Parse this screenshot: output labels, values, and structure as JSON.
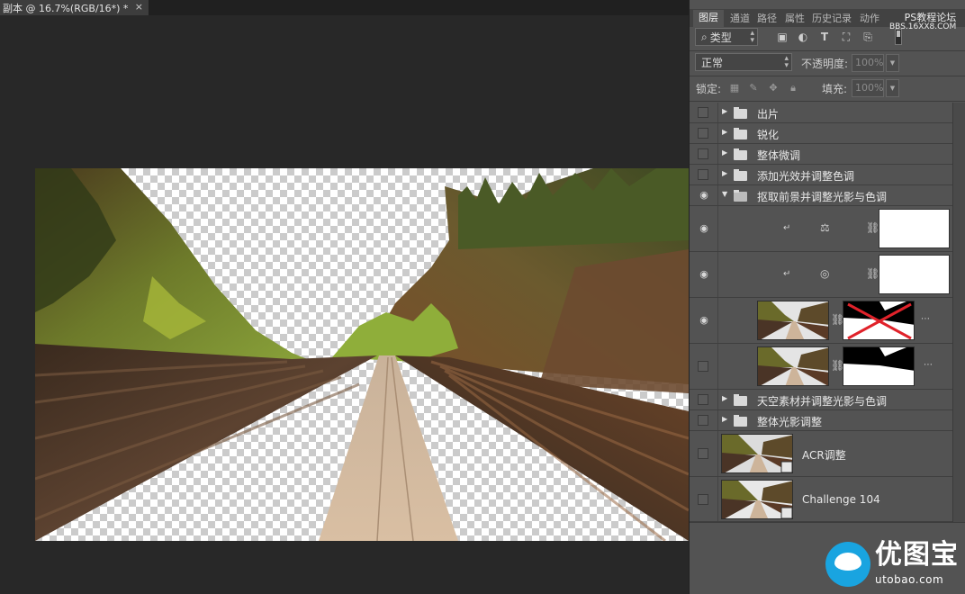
{
  "document": {
    "tab_title": "副本 @ 16.7%(RGB/16*) *",
    "close_glyph": "×"
  },
  "panel": {
    "tabs": [
      "图层",
      "通道",
      "路径",
      "属性",
      "历史记录",
      "动作"
    ],
    "watermark_top": "PS教程论坛",
    "watermark_url": "BBS.16XX8.COM",
    "filter_kind": "类型",
    "blend_mode": "正常",
    "opacity_label": "不透明度:",
    "opacity_value": "100%",
    "lock_label": "锁定:",
    "fill_label": "填充:",
    "fill_value": "100%"
  },
  "layers": [
    {
      "name": "出片",
      "type": "group",
      "visible": false,
      "expanded": false
    },
    {
      "name": "锐化",
      "type": "group",
      "visible": false,
      "expanded": false
    },
    {
      "name": "整体微调",
      "type": "group",
      "visible": false,
      "expanded": false
    },
    {
      "name": "添加光效并调整色调",
      "type": "group",
      "visible": false,
      "expanded": false
    },
    {
      "name": "抠取前景并调整光影与色调",
      "type": "group",
      "visible": true,
      "expanded": true
    },
    {
      "name": "",
      "type": "adjustment-balance",
      "visible": true,
      "clipped": true
    },
    {
      "name": "",
      "type": "adjustment-camera",
      "visible": true,
      "clipped": true
    },
    {
      "name": "",
      "type": "pixel-mask-disabled",
      "visible": true
    },
    {
      "name": "",
      "type": "pixel-mask",
      "visible": false
    },
    {
      "name": "天空素材并调整光影与色调",
      "type": "group",
      "visible": false,
      "expanded": false
    },
    {
      "name": "整体光影调整",
      "type": "group",
      "visible": false,
      "expanded": false
    },
    {
      "name": "ACR调整",
      "type": "smart-object",
      "visible": false
    },
    {
      "name": "Challenge 104",
      "type": "smart-object",
      "visible": false
    }
  ],
  "watermark_bottom": {
    "title": "优图宝",
    "url": "utobao.com"
  },
  "colors": {
    "canvas_bg": "#282828",
    "panel_bg": "#535353",
    "mask_cross": "#e0222a",
    "brand_blue": "#19a4e0"
  }
}
